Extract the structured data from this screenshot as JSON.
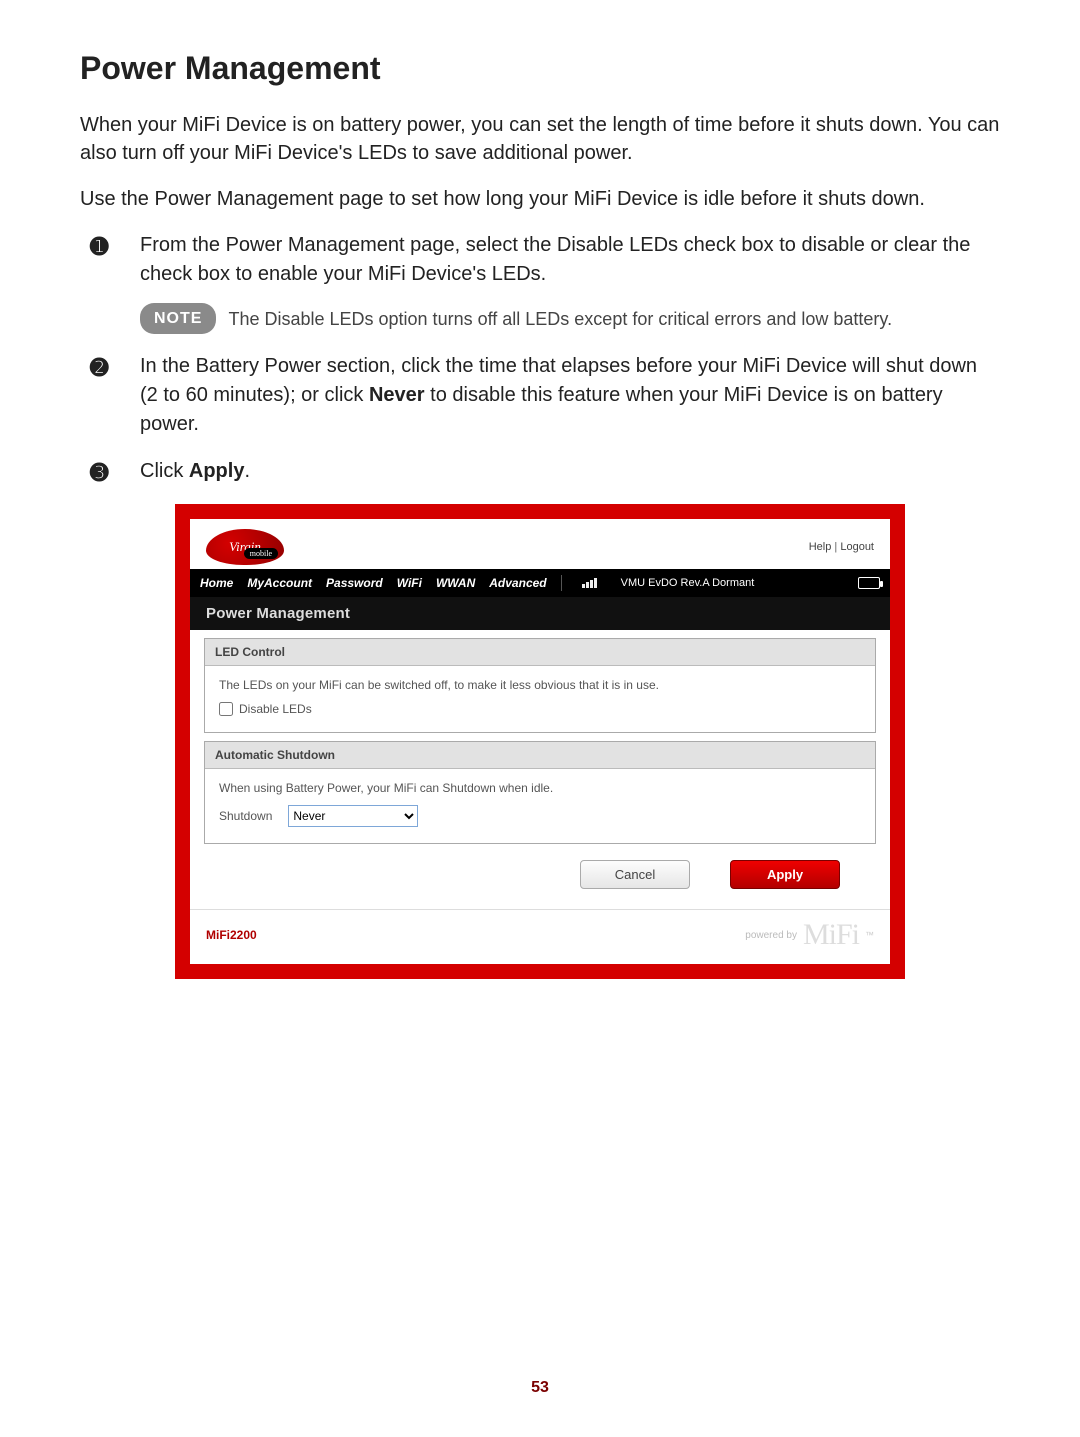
{
  "title": "Power Management",
  "intro1": "When your MiFi Device is on battery power, you can set the length of time before it shuts down. You can also turn off your MiFi Device's LEDs to save additional power.",
  "intro2": "Use the Power Management page to set how long your MiFi Device is idle before it shuts down.",
  "steps": {
    "s1_num": "➊",
    "s1": "From the Power Management page, select the Disable LEDs check box to disable or clear the check box to enable your MiFi Device's LEDs.",
    "note_label": "NOTE",
    "note_text": "The Disable LEDs option turns off all LEDs except for critical errors and low battery.",
    "s2_num": "➋",
    "s2_a": "In the Battery Power section, click the time that elapses before your MiFi Device will shut down (2 to 60 minutes); or click ",
    "s2_bold": "Never",
    "s2_b": " to disable this feature when your MiFi Device is on battery power.",
    "s3_num": "➌",
    "s3_a": "Click ",
    "s3_bold": "Apply",
    "s3_b": "."
  },
  "app": {
    "logo_main": "Virgin",
    "logo_sub": "mobile",
    "header_links": {
      "help": "Help",
      "sep": " | ",
      "logout": "Logout"
    },
    "nav": {
      "home": "Home",
      "myaccount": "MyAccount",
      "password": "Password",
      "wifi": "WiFi",
      "wwan": "WWAN",
      "advanced": "Advanced",
      "status": "VMU  EvDO Rev.A  Dormant"
    },
    "sub_title": "Power Management",
    "sections": {
      "led": {
        "header": "LED Control",
        "desc": "The LEDs on your MiFi can be switched off, to make it less obvious that it is in use.",
        "checkbox_label": "Disable LEDs",
        "checked": false
      },
      "auto": {
        "header": "Automatic Shutdown",
        "desc": "When using Battery Power, your MiFi can Shutdown when idle.",
        "label": "Shutdown",
        "selected": "Never"
      }
    },
    "buttons": {
      "cancel": "Cancel",
      "apply": "Apply"
    },
    "footer": {
      "model": "MiFi2200",
      "powered": "powered by",
      "brand": "MiFi",
      "tm": "™"
    }
  },
  "page_number": "53"
}
